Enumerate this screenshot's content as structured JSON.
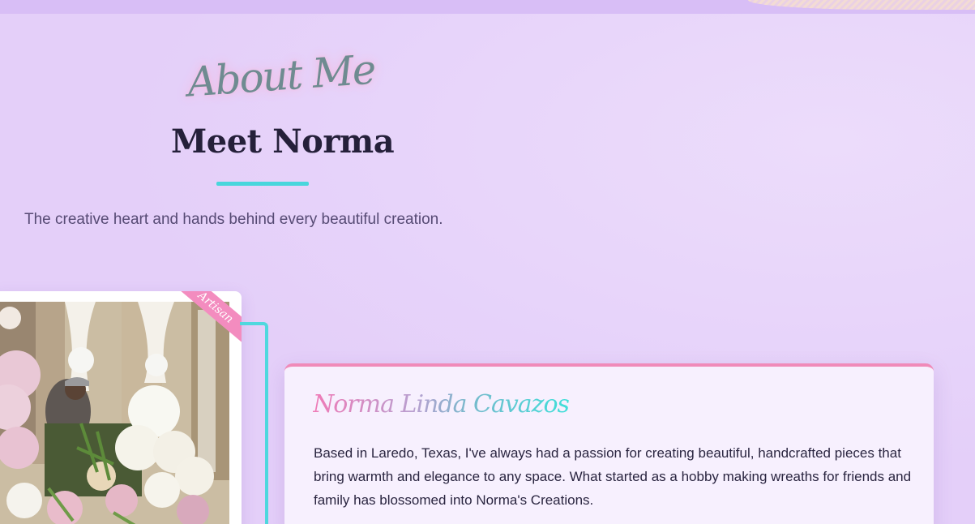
{
  "header": {
    "script_label": "About Me",
    "title": "Meet Norma",
    "tagline": "The creative heart and hands behind every beautiful creation."
  },
  "photo": {
    "ribbon_label": "Artisan",
    "description": "Norma arranging white and pink floral pieces at an event venue"
  },
  "card": {
    "name": "Norma Linda Cavazos",
    "bio": "Based in Laredo, Texas, I've always had a passion for creating beautiful, handcrafted pieces that bring warmth and elegance to any space. What started as a hobby making wreaths for friends and family has blossomed into Norma's Creations."
  },
  "colors": {
    "background": "#e4cff9",
    "accent_teal": "#48d6dc",
    "accent_pink": "#f08ab9",
    "title": "#25203a",
    "card_bg": "#f7f0fe"
  }
}
